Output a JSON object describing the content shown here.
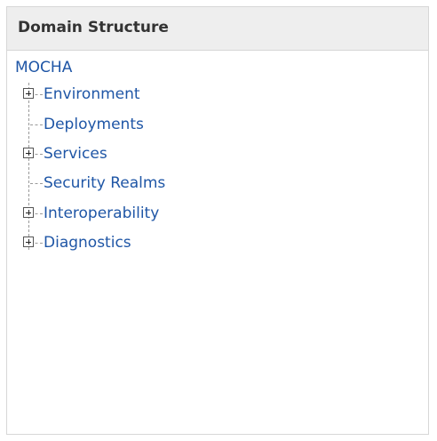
{
  "panel": {
    "title": "Domain Structure"
  },
  "tree": {
    "root": "MOCHA",
    "items": [
      {
        "label": "Environment",
        "expandable": true
      },
      {
        "label": "Deployments",
        "expandable": false
      },
      {
        "label": "Services",
        "expandable": true
      },
      {
        "label": "Security Realms",
        "expandable": false
      },
      {
        "label": "Interoperability",
        "expandable": true
      },
      {
        "label": "Diagnostics",
        "expandable": true
      }
    ]
  },
  "colors": {
    "link": "#1f56a6",
    "header_bg": "#eeeeee",
    "border": "#d7d7d7",
    "title": "#333333"
  },
  "icons": {
    "expander": "plus-box-icon"
  }
}
